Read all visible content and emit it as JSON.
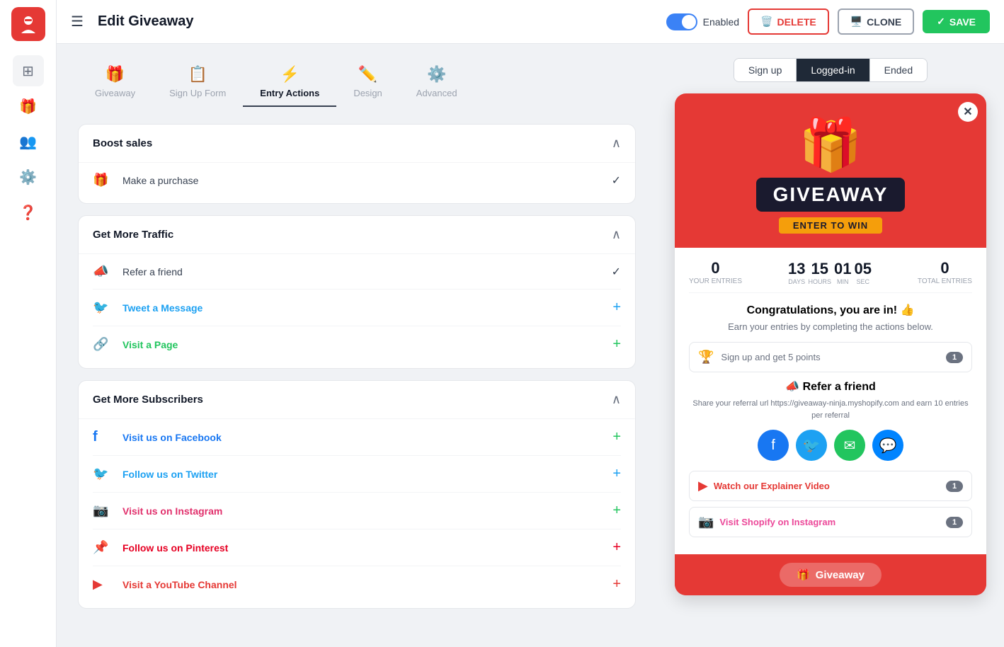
{
  "app": {
    "logo_alt": "App Logo"
  },
  "topbar": {
    "title": "Edit Giveaway",
    "menu_icon": "☰",
    "toggle_label": "Enabled",
    "btn_delete": "DELETE",
    "btn_clone": "CLONE",
    "btn_save": "SAVE"
  },
  "tabs": [
    {
      "id": "giveaway",
      "label": "Giveaway",
      "icon": "🎁"
    },
    {
      "id": "signup",
      "label": "Sign Up Form",
      "icon": "📋"
    },
    {
      "id": "entry",
      "label": "Entry Actions",
      "icon": "⚡"
    },
    {
      "id": "design",
      "label": "Design",
      "icon": "✏️"
    },
    {
      "id": "advanced",
      "label": "Advanced",
      "icon": "⚙️"
    }
  ],
  "sections": {
    "boost_sales": {
      "title": "Boost sales",
      "entries": [
        {
          "id": "purchase",
          "icon": "🎁",
          "label": "Make a purchase",
          "action": "check"
        }
      ]
    },
    "more_traffic": {
      "title": "Get More Traffic",
      "entries": [
        {
          "id": "refer",
          "icon": "📣",
          "label": "Refer a friend",
          "action": "check",
          "color": "default"
        },
        {
          "id": "tweet",
          "icon": "🐦",
          "label": "Tweet a Message",
          "action": "plus_blue",
          "color": "twitter"
        },
        {
          "id": "visit_page",
          "icon": "🔗",
          "label": "Visit a Page",
          "action": "plus",
          "color": "green"
        }
      ]
    },
    "more_subscribers": {
      "title": "Get More Subscribers",
      "entries": [
        {
          "id": "facebook",
          "icon": "f",
          "label": "Visit us on Facebook",
          "action": "plus",
          "color": "facebook"
        },
        {
          "id": "twitter",
          "icon": "🐦",
          "label": "Follow us on Twitter",
          "action": "plus_blue",
          "color": "twitter"
        },
        {
          "id": "instagram",
          "icon": "📷",
          "label": "Visit us on Instagram",
          "action": "plus",
          "color": "default"
        },
        {
          "id": "pinterest",
          "icon": "📌",
          "label": "Follow us on Pinterest",
          "action": "plus",
          "color": "pinterest"
        },
        {
          "id": "youtube",
          "icon": "▶",
          "label": "Visit a YouTube Channel",
          "action": "plus",
          "color": "youtube"
        }
      ]
    }
  },
  "preview": {
    "tabs": [
      "Sign up",
      "Logged-in",
      "Ended"
    ],
    "active_tab": "Logged-in",
    "widget": {
      "title": "GIVEAWAY",
      "subtitle": "ENTER TO WIN",
      "stats": {
        "your_entries": 0,
        "your_entries_label": "Your entries",
        "total_entries": 0,
        "total_entries_label": "Total entries"
      },
      "countdown": {
        "days": 13,
        "days_label": "DAYS",
        "hours": 15,
        "hours_label": "HOURS",
        "min": "01",
        "min_label": "MIN",
        "sec": "05",
        "sec_label": "SEC"
      },
      "congrats_text": "Congratulations, you are in! 👍",
      "earn_text": "Earn your entries by completing the actions below.",
      "signup_action": "Sign up and get 5 points",
      "signup_badge": "1",
      "refer_title": "📣 Refer a friend",
      "refer_url": "Share your referral url\nhttps://giveaway-ninja.myshopify.com\nand earn 10 entries per referral",
      "yt_label": "Watch our Explainer Video",
      "yt_badge": "1",
      "ig_label": "Visit Shopify on Instagram",
      "ig_badge": "1",
      "footer_tab": "Giveaway"
    }
  }
}
